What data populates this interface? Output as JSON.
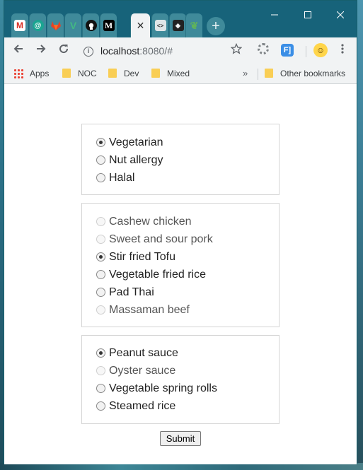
{
  "browser": {
    "url_host": "localhost",
    "url_path": ":8080/#",
    "tabs": [
      {
        "icon": "gmail-icon",
        "glyph": "M"
      },
      {
        "icon": "at-sign-icon",
        "glyph": "@"
      },
      {
        "icon": "gitlab-icon",
        "glyph": ""
      },
      {
        "icon": "vue-icon",
        "glyph": "V"
      },
      {
        "icon": "github-icon",
        "glyph": ""
      },
      {
        "icon": "medium-icon",
        "glyph": "M"
      },
      {
        "icon": "close-icon",
        "glyph": "✕",
        "active": true
      },
      {
        "icon": "code-icon",
        "glyph": "<>"
      },
      {
        "icon": "codepen-icon",
        "glyph": "◈"
      },
      {
        "icon": "leaf-icon",
        "glyph": "❦"
      }
    ],
    "new_tab": "+",
    "extension_badge": "F]",
    "bookmarks": [
      {
        "label": "Apps",
        "icon": "apps-grid-icon"
      },
      {
        "label": "NOC",
        "icon": "folder-icon"
      },
      {
        "label": "Dev",
        "icon": "folder-icon"
      },
      {
        "label": "Mixed",
        "icon": "folder-icon"
      }
    ],
    "bookmarks_more": "»",
    "other_bookmarks": "Other bookmarks"
  },
  "form": {
    "groups": [
      {
        "options": [
          {
            "label": "Vegetarian",
            "checked": true,
            "disabled": false
          },
          {
            "label": "Nut allergy",
            "checked": false,
            "disabled": false
          },
          {
            "label": "Halal",
            "checked": false,
            "disabled": false
          }
        ]
      },
      {
        "options": [
          {
            "label": "Cashew chicken",
            "checked": false,
            "disabled": true
          },
          {
            "label": "Sweet and sour pork",
            "checked": false,
            "disabled": true
          },
          {
            "label": "Stir fried Tofu",
            "checked": true,
            "disabled": false
          },
          {
            "label": "Vegetable fried rice",
            "checked": false,
            "disabled": false
          },
          {
            "label": "Pad Thai",
            "checked": false,
            "disabled": false
          },
          {
            "label": "Massaman beef",
            "checked": false,
            "disabled": true
          }
        ]
      },
      {
        "options": [
          {
            "label": "Peanut sauce",
            "checked": true,
            "disabled": false
          },
          {
            "label": "Oyster sauce",
            "checked": false,
            "disabled": true
          },
          {
            "label": "Vegetable spring rolls",
            "checked": false,
            "disabled": false
          },
          {
            "label": "Steamed rice",
            "checked": false,
            "disabled": false
          }
        ]
      }
    ],
    "submit_label": "Submit"
  }
}
